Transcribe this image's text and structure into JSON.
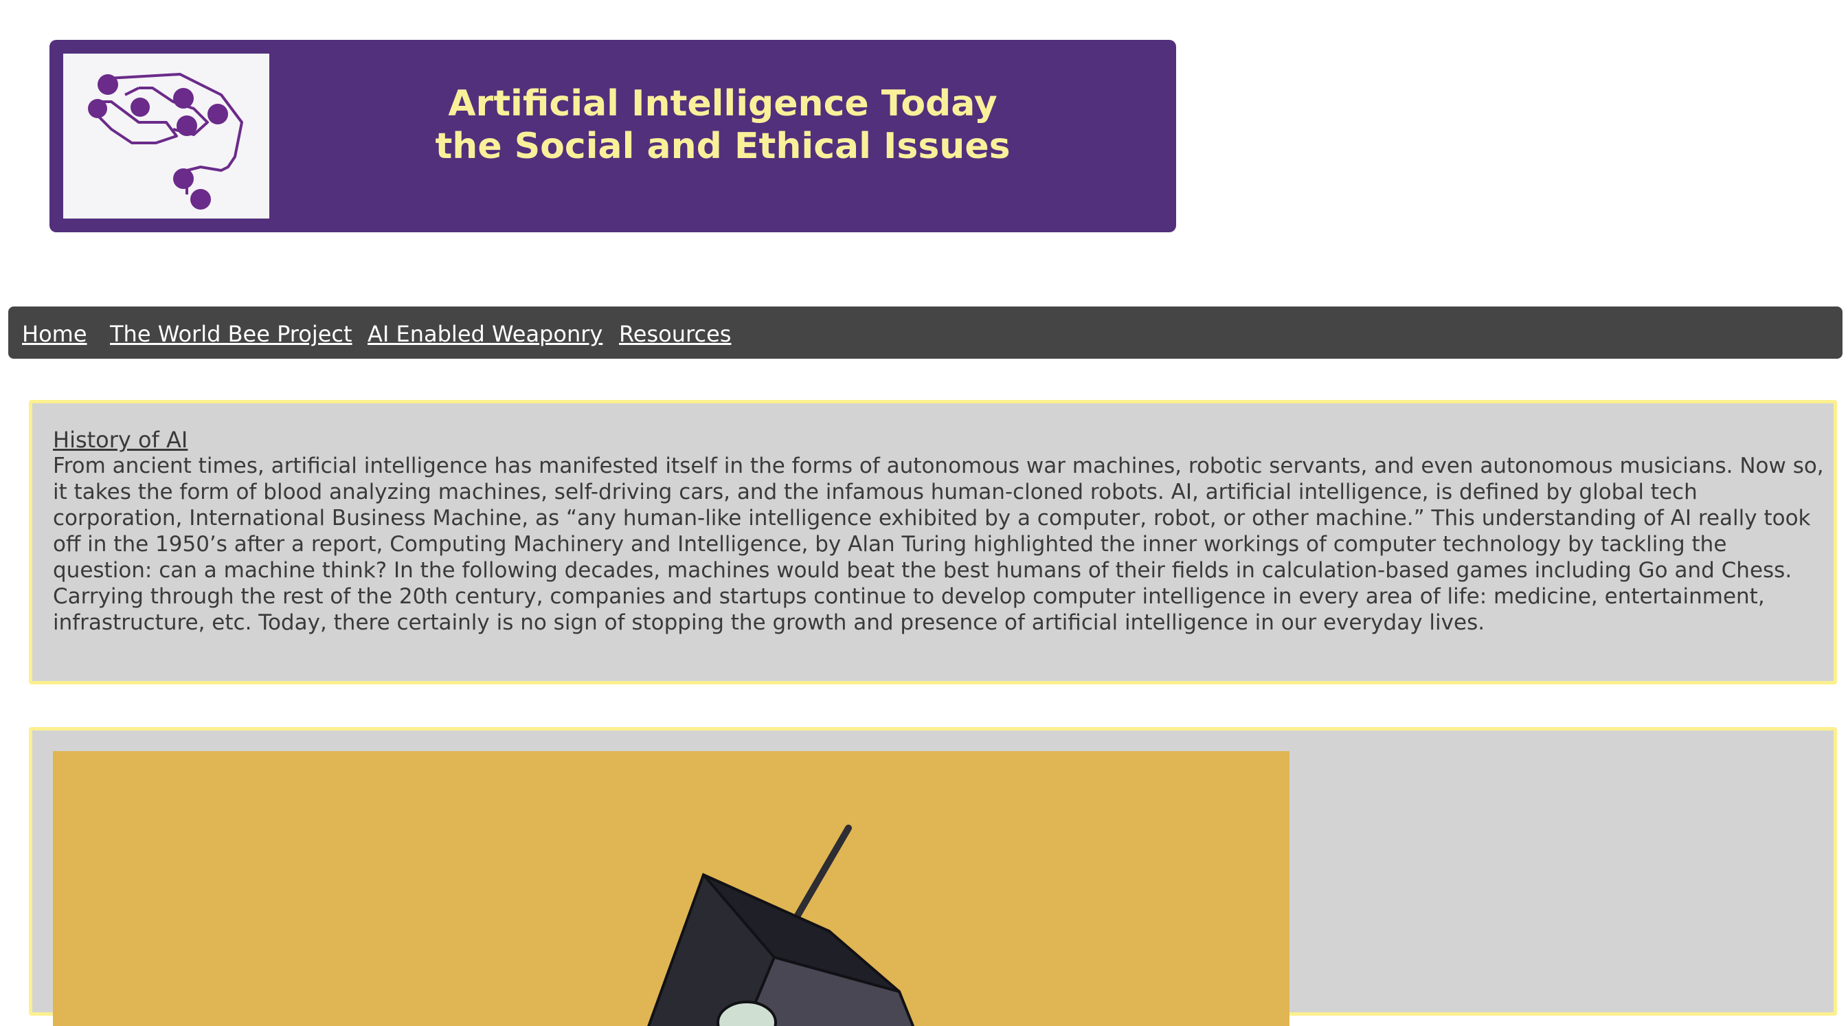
{
  "header": {
    "title_line1": "Artificial Intelligence Today",
    "title_line2": "the Social and Ethical Issues",
    "logo_icon": "brain-circuit-icon",
    "brand_color": "#52307c",
    "title_color": "#fbf09a"
  },
  "nav": {
    "items": [
      {
        "label": "Home"
      },
      {
        "label": "The World Bee Project"
      },
      {
        "label": "AI Enabled Weaponry"
      },
      {
        "label": "Resources"
      }
    ]
  },
  "history": {
    "heading": "History of AI",
    "body": "From ancient times, artificial intelligence has manifested itself in the forms of autonomous war machines, robotic servants, and even autonomous musicians. Now so, it takes the form of blood analyzing machines, self-driving cars, and the infamous human-cloned robots. AI, artificial intelligence, is defined by global tech corporation, International Business Machine, as “any human-like intelligence exhibited by a computer, robot, or other machine.” This understanding of AI really took off in the 1950’s after a report, Computing Machinery and Intelligence, by Alan Turing highlighted the inner workings of computer technology by tackling the question: can a machine think? In the following decades, machines would beat the best humans of their fields in calculation-based games including Go and Chess. Carrying through the rest of the 20th century, companies and startups continue to develop computer intelligence in every area of life: medicine, entertainment, infrastructure, etc. Today, there certainly is no sign of stopping the growth and presence of artificial intelligence in our everyday lives."
  },
  "illustration": {
    "icon": "robot-head-illustration",
    "background_color": "#e0b553"
  }
}
